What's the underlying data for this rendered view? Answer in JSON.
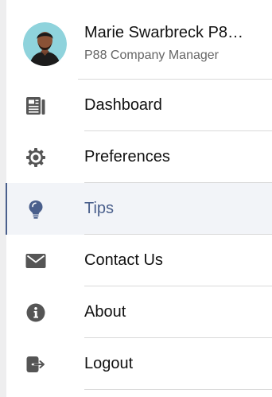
{
  "profile": {
    "name": "Marie Swarbreck P8…",
    "role": "P88 Company Manager"
  },
  "menu": {
    "items": [
      {
        "label": "Dashboard",
        "icon": "newspaper-icon"
      },
      {
        "label": "Preferences",
        "icon": "gear-icon"
      },
      {
        "label": "Tips",
        "icon": "lightbulb-icon",
        "active": true
      },
      {
        "label": "Contact Us",
        "icon": "envelope-icon"
      },
      {
        "label": "About",
        "icon": "info-icon"
      },
      {
        "label": "Logout",
        "icon": "logout-icon"
      }
    ]
  },
  "colors": {
    "icon": "#555555",
    "active_accent": "#4a5f8c",
    "active_background": "#f2f4f8",
    "divider": "#d9d9d9"
  }
}
